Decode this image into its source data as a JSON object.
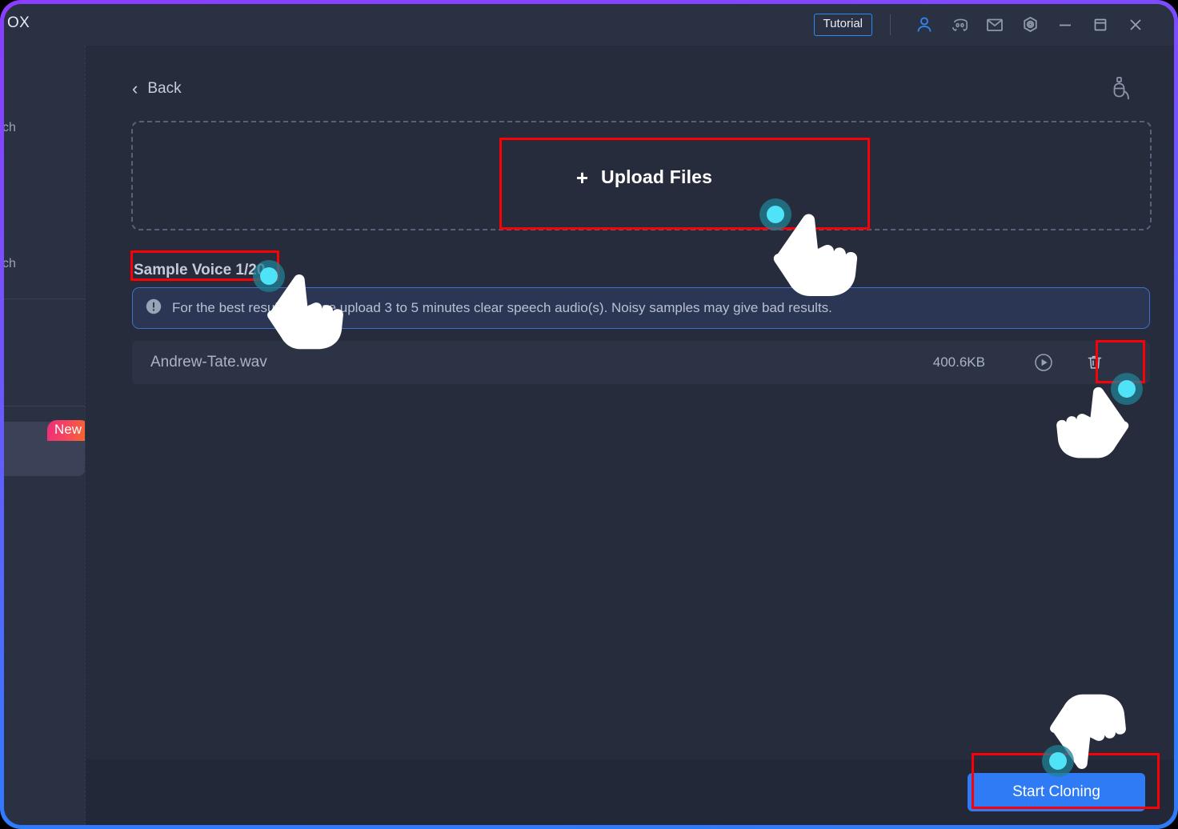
{
  "window": {
    "brand": "OX",
    "border_gradient_from": "#8B3DFF",
    "border_gradient_to": "#2F7BF6"
  },
  "titlebar": {
    "tutorial_label": "Tutorial",
    "icons": [
      {
        "name": "account-icon",
        "label": "Account"
      },
      {
        "name": "discord-icon",
        "label": "Discord"
      },
      {
        "name": "mail-icon",
        "label": "Mail"
      },
      {
        "name": "settings-icon",
        "label": "Settings"
      },
      {
        "name": "minimize-icon",
        "label": "Minimize"
      },
      {
        "name": "maximize-icon",
        "label": "Maximize"
      },
      {
        "name": "close-icon",
        "label": "Close"
      }
    ],
    "accent_color": "#2f89f5"
  },
  "sidebar": {
    "item_1_label": "ch",
    "item_2_label": "ch",
    "new_badge": "New"
  },
  "topbar": {
    "back_label": "Back",
    "back_chevron": "‹",
    "mic_icon_name": "microphone-plug-icon"
  },
  "dropzone": {
    "upload_plus": "+",
    "upload_label": "Upload Files"
  },
  "sample": {
    "heading": "Sample Voice 1/20"
  },
  "info": {
    "text": "For the best results, please upload 3 to 5 minutes clear speech audio(s). Noisy samples may give bad results.",
    "border_color": "#3f6fd0",
    "background_color": "#2b3554"
  },
  "files": {
    "columns": [
      "name",
      "size",
      "play",
      "delete"
    ],
    "rows": [
      {
        "name": "Andrew-Tate.wav",
        "size": "400.6KB"
      }
    ]
  },
  "footer": {
    "start_label": "Start Cloning",
    "start_color": "#2f7bf6"
  },
  "annotations": {
    "box_color": "#fb0007",
    "marker_color": "#4fe3f7",
    "boxes": [
      "upload-files",
      "sample-voice-heading",
      "delete-file",
      "start-cloning"
    ]
  }
}
